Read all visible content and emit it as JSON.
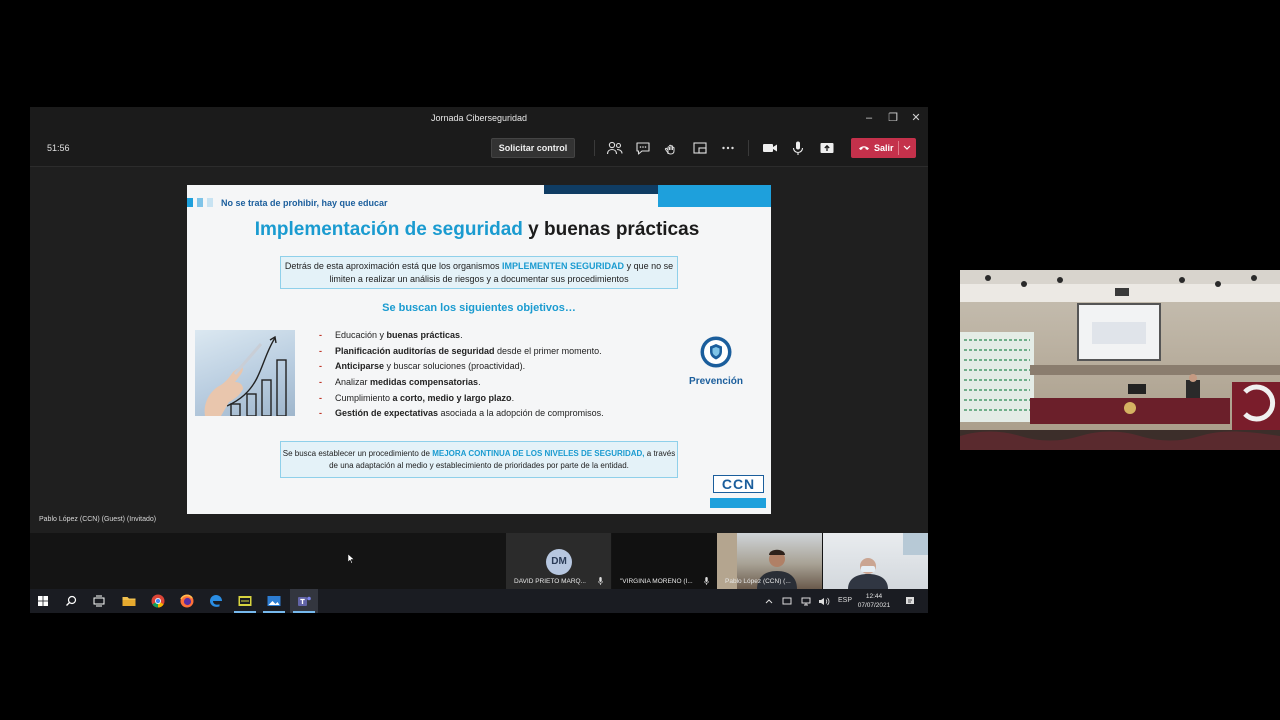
{
  "window": {
    "title": "Jornada Ciberseguridad",
    "controls": [
      "minimize-icon",
      "restore-icon",
      "close-icon"
    ]
  },
  "toolbar": {
    "timer": "51:56",
    "request_control_label": "Solicitar control",
    "icons": [
      "people-icon",
      "chat-icon",
      "reactions-icon",
      "rooms-icon",
      "more-icon",
      "camera-icon",
      "mic-icon",
      "share-icon"
    ],
    "leave_label": "Salir",
    "leave_color": "#c4314b"
  },
  "presenter_label": "Pablo López (CCN) (Guest) (Invitado)",
  "slide": {
    "top_label": "No se trata de prohibir, hay que educar",
    "title_highlight": "Implementación de seguridad",
    "title_rest": "y buenas prácticas",
    "intro_pre": "Detrás de esta aproximación está que los organismos",
    "intro_highlight": "IMPLEMENTEN SEGURIDAD",
    "intro_post": "y que no se limiten a realizar un análisis de riesgos y a documentar sus procedimientos",
    "objectives_title": "Se buscan los siguientes objetivos…",
    "bullets": [
      {
        "pre": "Educación y ",
        "bold": "buenas prácticas",
        "post": "."
      },
      {
        "pre": "",
        "bold": "Planificación auditorías de seguridad",
        "post": " desde el primer momento."
      },
      {
        "pre": "",
        "bold": "Anticiparse",
        "post": " y buscar soluciones (proactividad)."
      },
      {
        "pre": "Analizar ",
        "bold": "medidas compensatorias",
        "post": "."
      },
      {
        "pre": "Cumplimiento ",
        "bold": "a corto, medio y largo plazo",
        "post": "."
      },
      {
        "pre": "",
        "bold": "Gestión de expectativas",
        "post": " asociada a la adopción de compromisos."
      }
    ],
    "side_label": "Prevención",
    "closing_pre": "Se busca establecer un procedimiento de",
    "closing_highlight": "MEJORA CONTINUA DE LOS NIVELES DE SEGURIDAD,",
    "closing_post": "a través de una adaptación al medio y establecimiento de prioridades por parte de la entidad.",
    "logo_text": "CCN",
    "accent_color": "#1a9bd0",
    "dark_color": "#1b5e9c"
  },
  "participants": [
    {
      "initials": "DM",
      "name": "DAVID PRIETO MARQ..."
    },
    {
      "initials": "",
      "name": "\"VIRGINIA MORENO (I..."
    },
    {
      "initials": "",
      "name": "Pablo López (CCN) (..."
    },
    {
      "initials": "",
      "name": ""
    }
  ],
  "taskbar": {
    "language": "ESP",
    "time": "12:44",
    "date": "07/07/2021"
  }
}
